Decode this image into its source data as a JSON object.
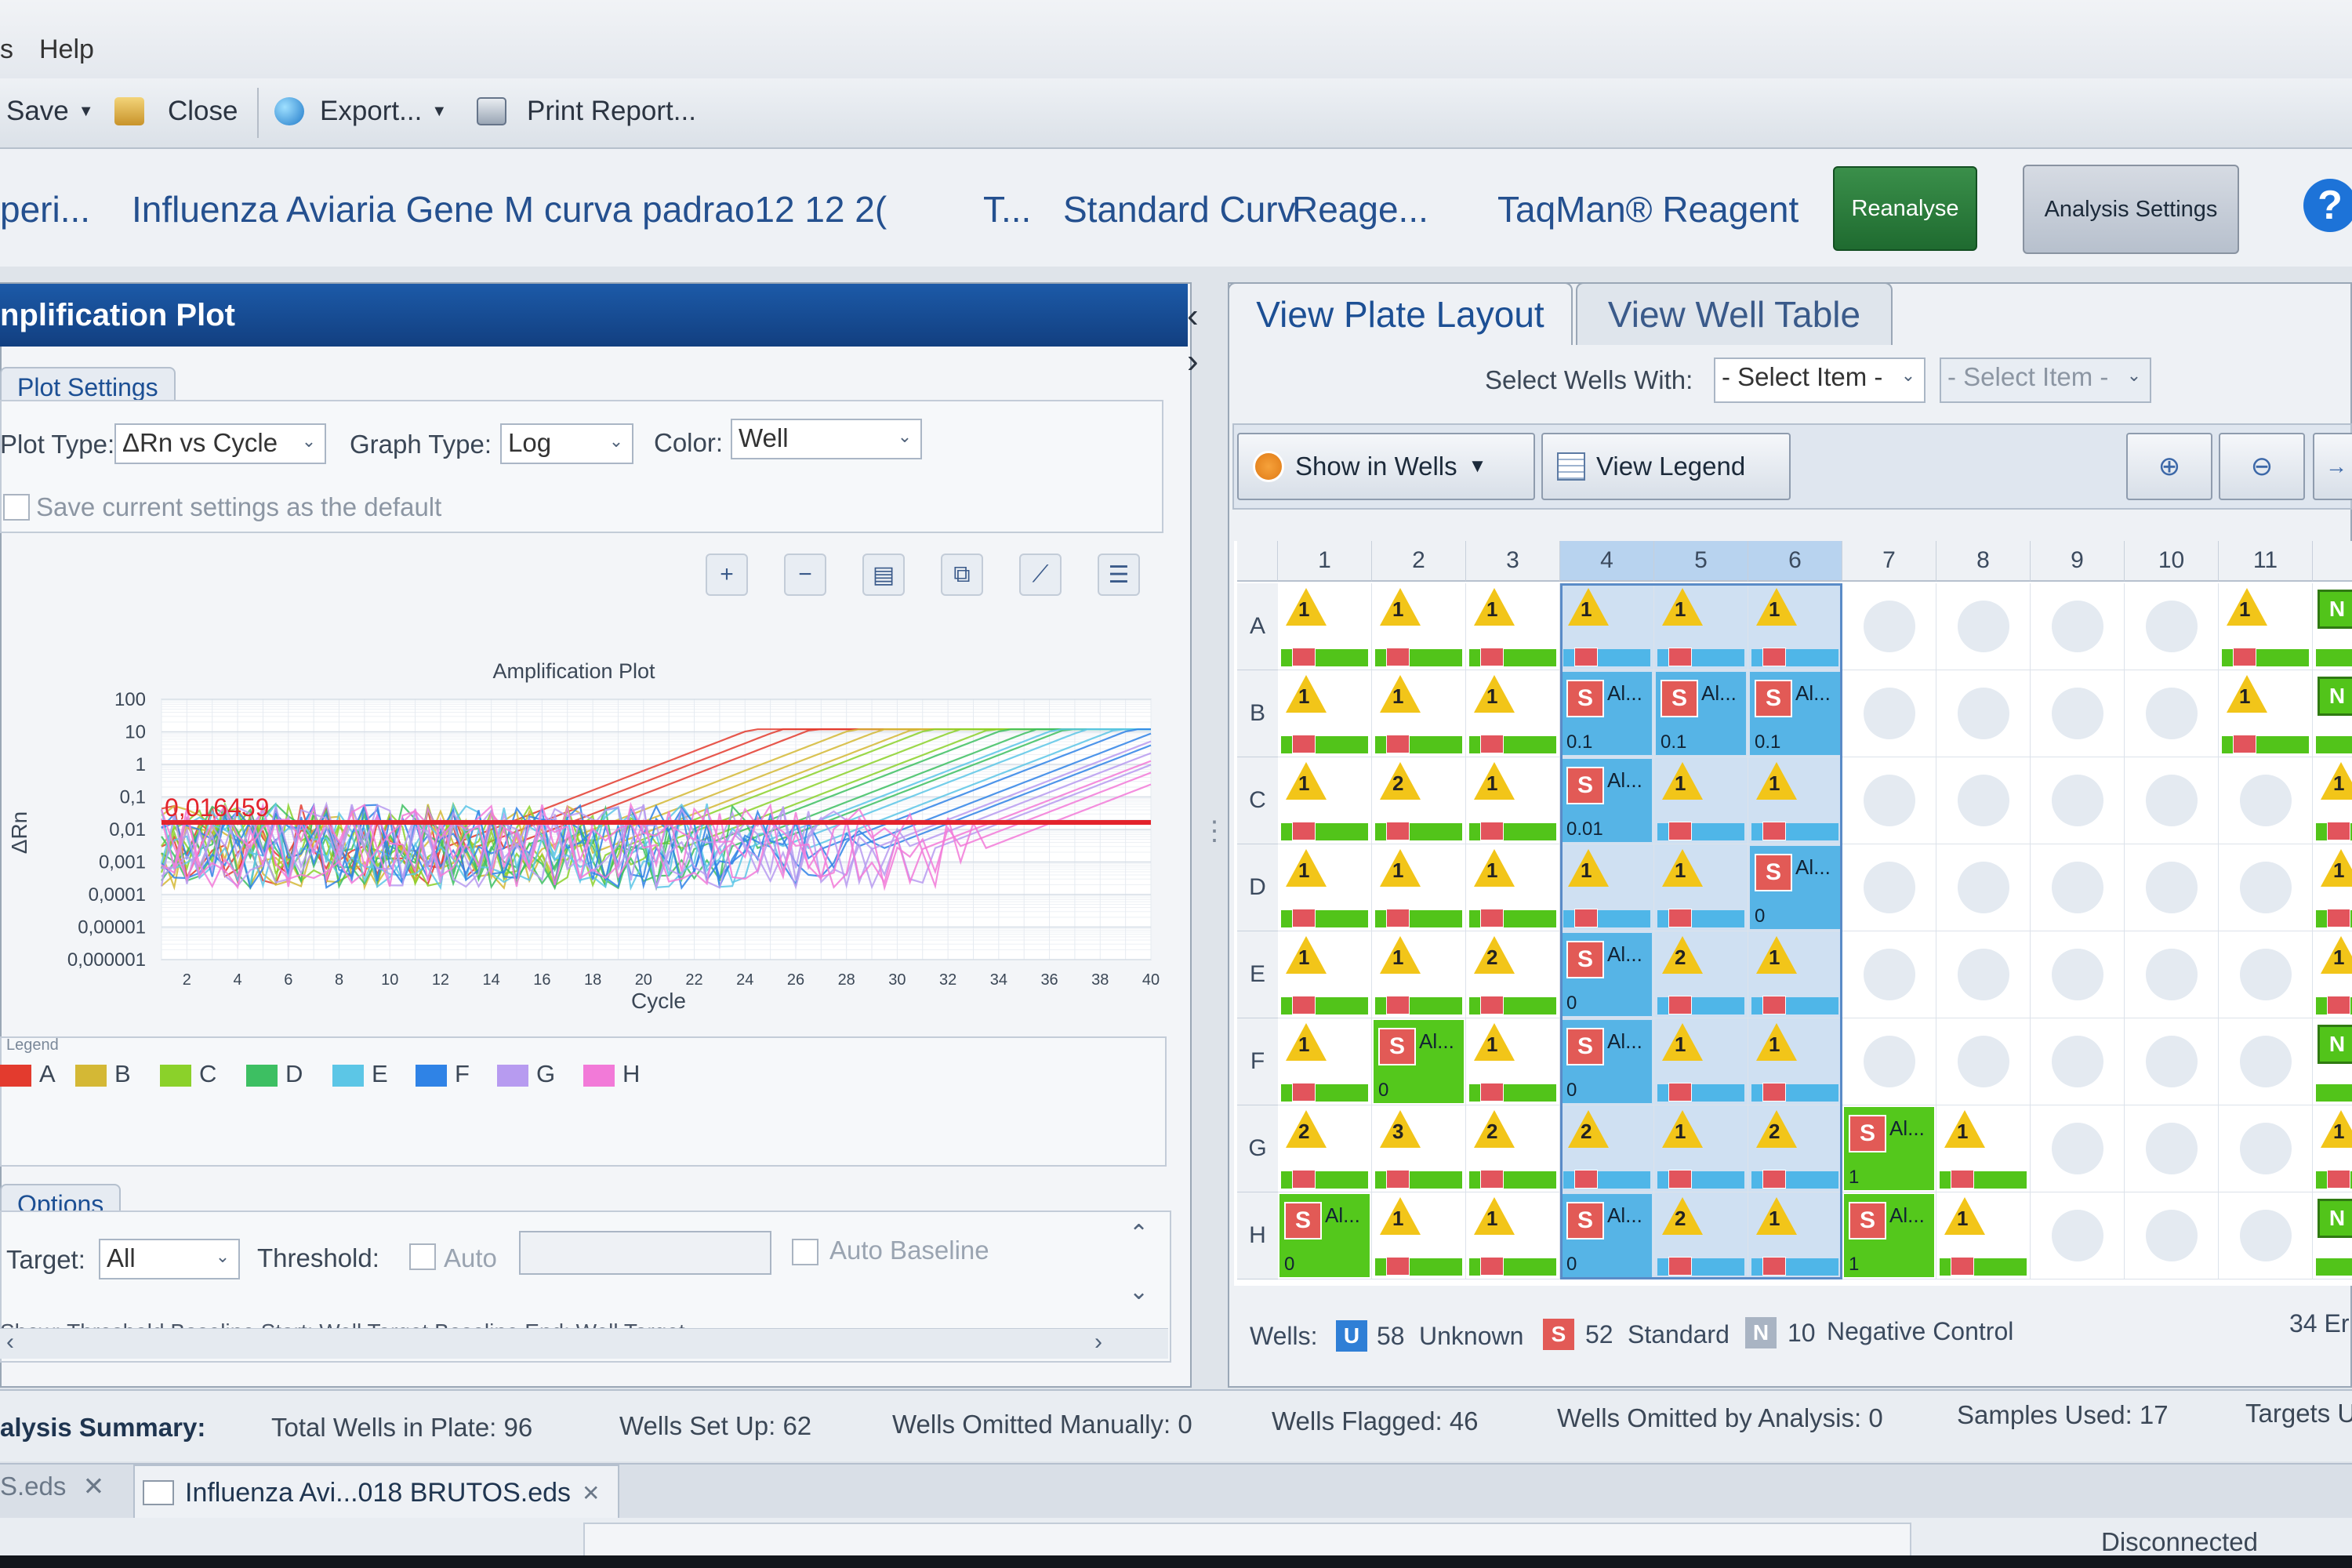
{
  "menu": {
    "partial": "s",
    "help": "Help"
  },
  "toolbar": {
    "save": "Save",
    "close": "Close",
    "export": "Export...",
    "print": "Print Report..."
  },
  "title": {
    "experiment": "peri...",
    "name": "Influenza Aviaria Gene M curva padrao12 12 2(",
    "t": "T...",
    "type": "Standard Curv",
    "reagent_label": "Reage...",
    "reagent": "TaqMan® Reagent"
  },
  "buttons": {
    "reanalyse": "Reanalyse",
    "analysis_settings": "Analysis Settings",
    "help": "?"
  },
  "left": {
    "header": "nplification Plot",
    "plot_settings_tab": "Plot Settings",
    "plot_type_label": "Plot Type:",
    "plot_type_value": "ΔRn vs Cycle",
    "graph_type_label": "Graph Type:",
    "graph_type_value": "Log",
    "color_label": "Color:",
    "color_value": "Well",
    "save_default": "Save current settings as the default",
    "legend_title": "Legend",
    "legend": [
      {
        "label": "A",
        "color": "#e33b2e"
      },
      {
        "label": "B",
        "color": "#d4b835"
      },
      {
        "label": "C",
        "color": "#8bd12a"
      },
      {
        "label": "D",
        "color": "#3dbf62"
      },
      {
        "label": "E",
        "color": "#5cc6e6"
      },
      {
        "label": "F",
        "color": "#2f83e6"
      },
      {
        "label": "G",
        "color": "#b79bf0"
      },
      {
        "label": "H",
        "color": "#f27ad8"
      }
    ],
    "options_tab": "Options",
    "target_label": "Target:",
    "target_value": "All",
    "threshold_label": "Threshold:",
    "auto_label": "Auto",
    "auto_baseline": "Auto Baseline",
    "cut_row": "Show: Threshold   Baseline Start: Well   Target   Baseline End: Well   Target"
  },
  "chart_data": {
    "type": "line",
    "title": "Amplification Plot",
    "xlabel": "Cycle",
    "ylabel": "ΔRn",
    "y_scale": "log",
    "xlim": [
      1,
      40
    ],
    "ylim": [
      1e-06,
      100
    ],
    "x_ticks": [
      2,
      4,
      6,
      8,
      10,
      12,
      14,
      16,
      18,
      20,
      22,
      24,
      26,
      28,
      30,
      32,
      34,
      36,
      38,
      40
    ],
    "y_ticks": [
      "100",
      "10",
      "1",
      "0,1",
      "0,01",
      "0,001",
      "0,0001",
      "0,00001",
      "0,000001"
    ],
    "threshold": 0.016459,
    "threshold_label": "0,016459",
    "series": [
      {
        "color": "#e33b2e",
        "ct": 16
      },
      {
        "color": "#d4b835",
        "ct": 20
      },
      {
        "color": "#8bd12a",
        "ct": 23
      },
      {
        "color": "#3dbf62",
        "ct": 26
      },
      {
        "color": "#5cc6e6",
        "ct": 28
      },
      {
        "color": "#2f83e6",
        "ct": 31
      },
      {
        "color": "#b79bf0",
        "ct": 33
      },
      {
        "color": "#f27ad8",
        "ct": 35
      }
    ]
  },
  "right": {
    "tab_plate": "View Plate Layout",
    "tab_table": "View Well Table",
    "select_wells_label": "Select Wells With:",
    "select1": "- Select Item -",
    "select2": "- Select Item -",
    "show_in_wells": "Show in Wells",
    "view_legend": "View Legend",
    "columns": [
      "1",
      "2",
      "3",
      "4",
      "5",
      "6",
      "7",
      "8",
      "9",
      "10",
      "11",
      "1"
    ],
    "rows": [
      "A",
      "B",
      "C",
      "D",
      "E",
      "F",
      "G",
      "H"
    ],
    "wells": [
      [
        "U1",
        "U1",
        "U1",
        "U1b",
        "U1b",
        "U1b",
        "E",
        "E",
        "E",
        "E",
        "U1",
        "N"
      ],
      [
        "U1",
        "U1",
        "U1",
        "S:0.1",
        "S:0.1",
        "S:0.1",
        "E",
        "E",
        "E",
        "E",
        "U1",
        "N"
      ],
      [
        "U1",
        "U2",
        "U1",
        "S:0.01",
        "U1b",
        "U1b",
        "E",
        "E",
        "E",
        "E",
        "E",
        "U1"
      ],
      [
        "U1",
        "U1",
        "U1",
        "U1b",
        "U1b",
        "S:0",
        "E",
        "E",
        "E",
        "E",
        "E",
        "U1"
      ],
      [
        "U1",
        "U1",
        "U2",
        "S:0",
        "U2b",
        "U1b",
        "E",
        "E",
        "E",
        "E",
        "E",
        "U1"
      ],
      [
        "U1",
        "SG:0",
        "U1",
        "S:0",
        "U1b",
        "U1b",
        "E",
        "E",
        "E",
        "E",
        "E",
        "N"
      ],
      [
        "U2",
        "U3",
        "U2",
        "U2b",
        "U1b",
        "U2b",
        "SG:1",
        "U1",
        "E",
        "E",
        "E",
        "U1"
      ],
      [
        "SG:0",
        "U1",
        "U1",
        "S:0",
        "U2b",
        "U1b",
        "SG:1",
        "U1",
        "E",
        "E",
        "E",
        "N"
      ]
    ],
    "s_text": "Al...",
    "wells_summary_label": "Wells:",
    "unknown_badge": "U",
    "unknown_count": "58",
    "unknown_label": "Unknown",
    "standard_badge": "S",
    "standard_count": "52",
    "standard_label": "Standard",
    "neg_badge": "N",
    "neg_count": "10",
    "neg_label": "Negative Control",
    "empty_count": "34 Er"
  },
  "summary": {
    "label": "alysis Summary:",
    "total": "Total Wells in Plate: 96",
    "setup": "Wells Set Up: 62",
    "omitted_manual": "Wells Omitted Manually: 0",
    "flagged": "Wells Flagged: 46",
    "omitted_analysis": "Wells Omitted by Analysis: 0",
    "samples": "Samples Used: 17",
    "targets": "Targets U"
  },
  "tabs": {
    "tab1": "S.eds",
    "tab2": "Influenza Avi...018 BRUTOS.eds"
  },
  "status": {
    "connection": "Disconnected"
  }
}
